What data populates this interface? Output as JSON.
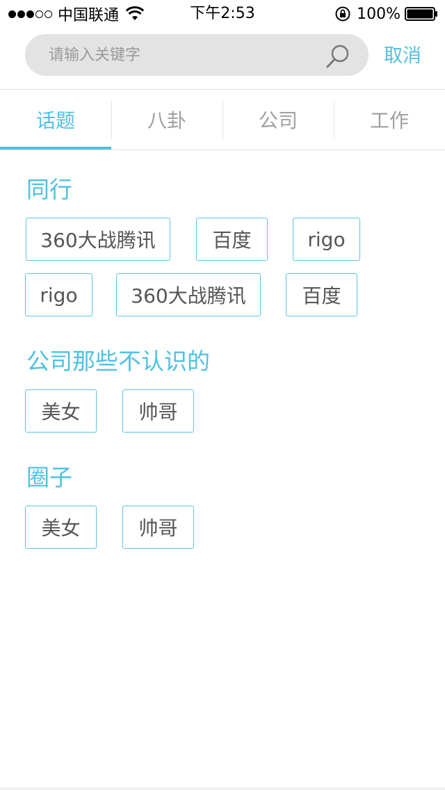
{
  "status_bar": {
    "carrier": "中国联通",
    "time": "下午2:53",
    "battery": "100%"
  },
  "search": {
    "placeholder": "请输入关键字",
    "cancel_label": "取消"
  },
  "tabs": [
    {
      "label": "话题",
      "active": true
    },
    {
      "label": "八卦",
      "active": false
    },
    {
      "label": "公司",
      "active": false
    },
    {
      "label": "工作",
      "active": false
    }
  ],
  "sections": [
    {
      "title": "同行",
      "tags": [
        "360大战腾讯",
        "百度",
        "rigo",
        "rigo",
        "360大战腾讯",
        "百度"
      ]
    },
    {
      "title": "公司那些不认识的",
      "tags": [
        "美女",
        "帅哥"
      ]
    },
    {
      "title": "圈子",
      "tags": [
        "美女",
        "帅哥"
      ]
    }
  ],
  "colors": {
    "accent": "#4fc1e0",
    "tag_border": "#5cc3e0",
    "search_bg": "#e3e3e3",
    "inactive_tab": "#a0a0a0"
  }
}
